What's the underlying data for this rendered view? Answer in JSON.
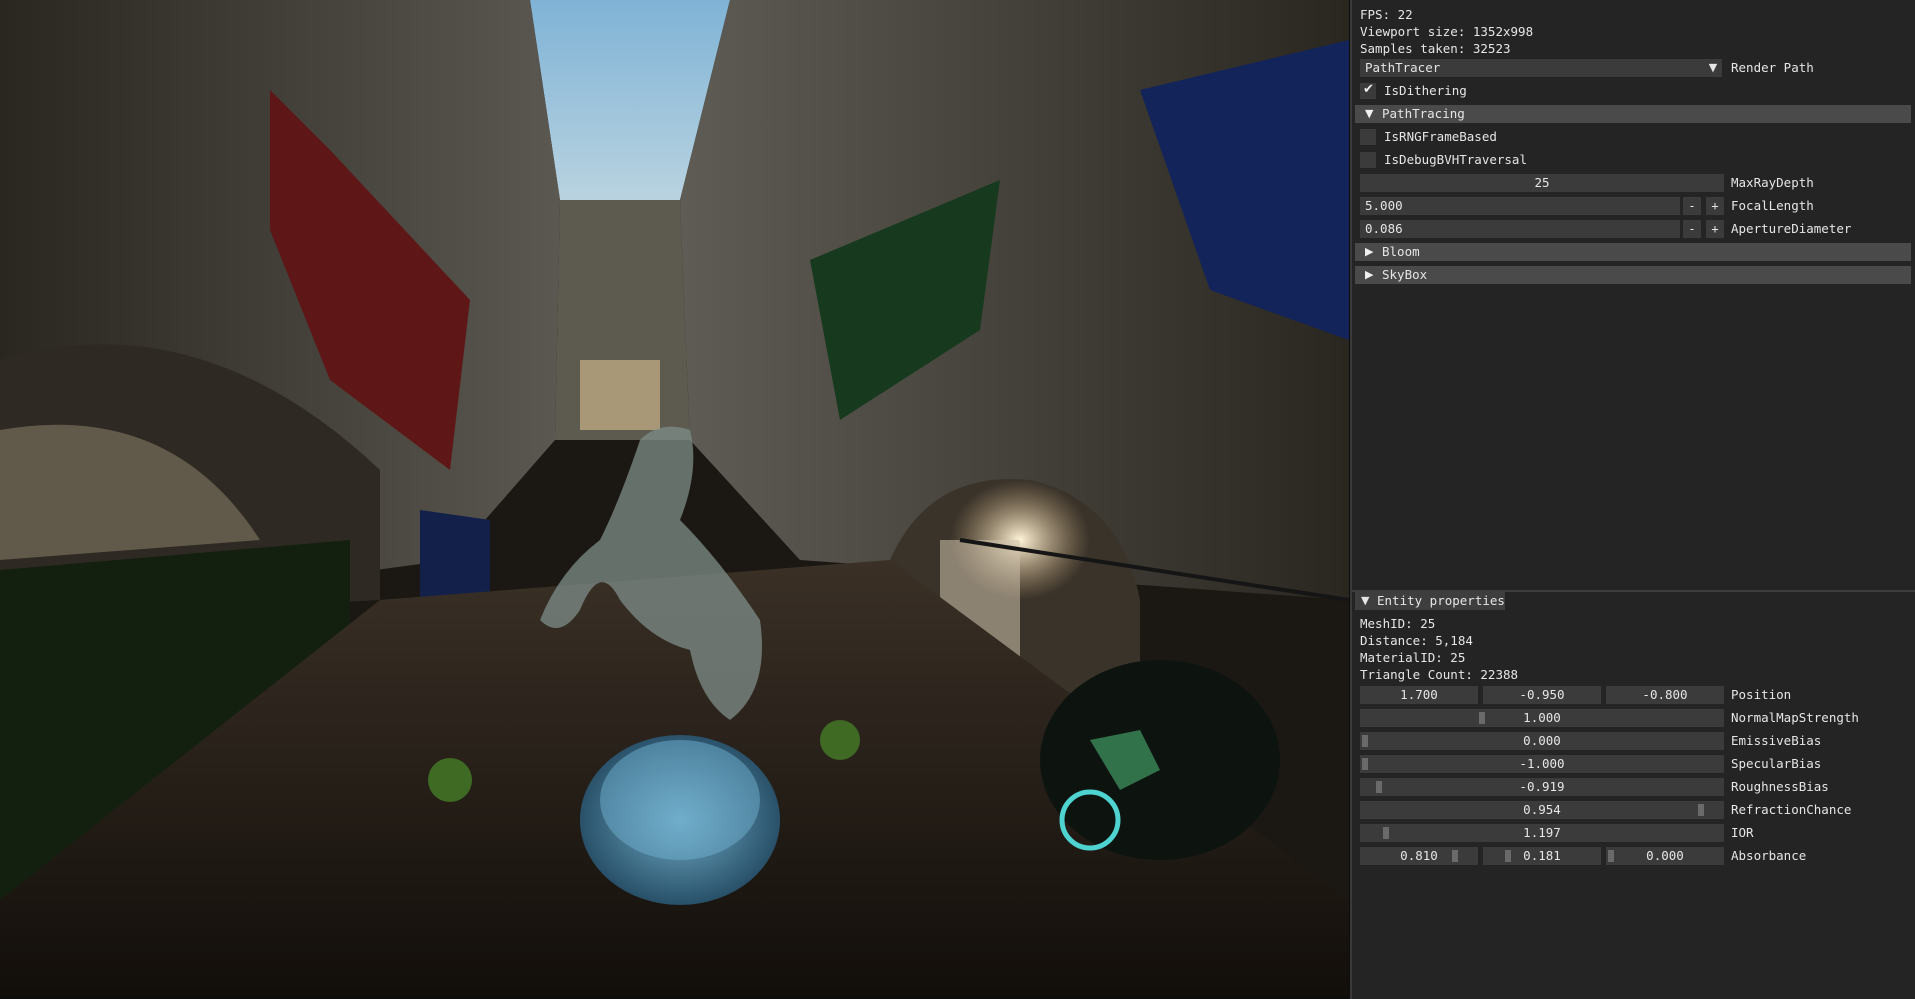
{
  "stats": {
    "fps": "FPS: 22",
    "viewport_size": "Viewport size: 1352x998",
    "samples": "Samples taken: 32523"
  },
  "render_path": {
    "value": "PathTracer",
    "label": "Render Path"
  },
  "is_dithering": {
    "label": "IsDithering",
    "checked": true
  },
  "path_tracing": {
    "header": "PathTracing",
    "is_rng_frame_based": "IsRNGFrameBased",
    "is_debug_bvh": "IsDebugBVHTraversal",
    "max_ray_depth": {
      "value": "25",
      "label": "MaxRayDepth"
    },
    "focal_length": {
      "value": "5.000",
      "label": "FocalLength"
    },
    "aperture": {
      "value": "0.086",
      "label": "ApertureDiameter"
    },
    "minus": "-",
    "plus": "+"
  },
  "bloom_header": "Bloom",
  "skybox_header": "SkyBox",
  "entity": {
    "header": "Entity properties",
    "mesh_id": "MeshID: 25",
    "distance": "Distance: 5,184",
    "material_id": "MaterialID: 25",
    "triangle_count": "Triangle Count: 22388",
    "position": {
      "x": "1.700",
      "y": "-0.950",
      "z": "-0.800",
      "label": "Position"
    },
    "normal_map_strength": {
      "value": "1.000",
      "label": "NormalMapStrength",
      "fraction": 0.33
    },
    "emissive_bias": {
      "value": "0.000",
      "label": "EmissiveBias",
      "fraction": 0.0
    },
    "specular_bias": {
      "value": "-1.000",
      "label": "SpecularBias",
      "fraction": 0.0
    },
    "roughness_bias": {
      "value": "-0.919",
      "label": "RoughnessBias",
      "fraction": 0.04
    },
    "refraction_chance": {
      "value": "0.954",
      "label": "RefractionChance",
      "fraction": 0.95
    },
    "ior": {
      "value": "1.197",
      "label": "IOR",
      "fraction": 0.06
    },
    "absorbance": {
      "r": "0.810",
      "g": "0.181",
      "b": "0.000",
      "label": "Absorbance"
    }
  },
  "colors": {
    "panel_bg": "#242424",
    "field_bg": "#3b3b3b",
    "header_bg": "#4a4a4a",
    "sky": "#8ab8d6"
  }
}
